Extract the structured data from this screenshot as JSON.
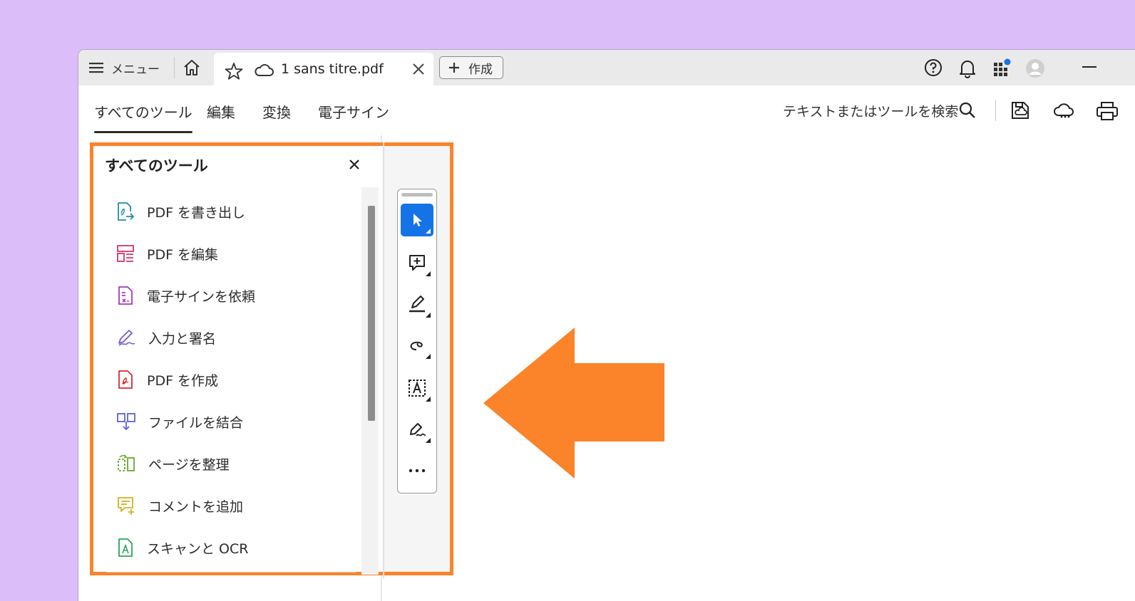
{
  "colors": {
    "background": "#dbbdf9",
    "accent": "#fb8329",
    "selected": "#1473e6"
  },
  "titlebar": {
    "menu_label": "メニュー",
    "tab_title": "1 sans titre.pdf",
    "create_label": "作成"
  },
  "navtabs": [
    "すべてのツール",
    "編集",
    "変換",
    "電子サイン"
  ],
  "search": {
    "label": "テキストまたはツールを検索"
  },
  "panel": {
    "title": "すべてのツール",
    "items": [
      {
        "label": "PDF を書き出し",
        "icon": "export-pdf-icon"
      },
      {
        "label": "PDF を編集",
        "icon": "edit-pdf-icon"
      },
      {
        "label": "電子サインを依頼",
        "icon": "request-esign-icon"
      },
      {
        "label": "入力と署名",
        "icon": "fill-sign-icon"
      },
      {
        "label": "PDF を作成",
        "icon": "create-pdf-icon"
      },
      {
        "label": "ファイルを結合",
        "icon": "combine-files-icon"
      },
      {
        "label": "ページを整理",
        "icon": "organize-pages-icon"
      },
      {
        "label": "コメントを追加",
        "icon": "add-comment-icon"
      },
      {
        "label": "スキャンと OCR",
        "icon": "scan-ocr-icon"
      }
    ]
  },
  "quick_tools": [
    "select-icon",
    "add-comment-icon",
    "highlight-icon",
    "draw-icon",
    "text-box-icon",
    "sign-icon",
    "more-icon"
  ]
}
